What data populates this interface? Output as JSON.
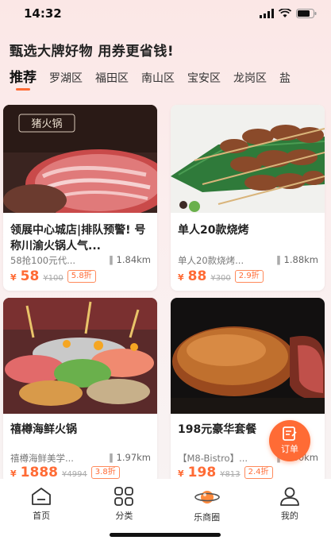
{
  "status_bar": {
    "time": "14:32"
  },
  "headline": "甄选大牌好物 用券更省钱!",
  "tabs": [
    "推荐",
    "罗湖区",
    "福田区",
    "南山区",
    "宝安区",
    "龙岗区",
    "盐"
  ],
  "cards": [
    {
      "title": "领展中心城店|排队预警! 号称川渝火锅人气...",
      "sub": "58抢100元代...",
      "distance": "1.84km",
      "currency": "¥",
      "price": "58",
      "original_price": "¥100",
      "discount": "5.8折",
      "image_label": "猪火锅"
    },
    {
      "title": "单人20款烧烤",
      "sub": "单人20款烧烤...",
      "distance": "1.88km",
      "currency": "¥",
      "price": "88",
      "original_price": "¥300",
      "discount": "2.9折"
    },
    {
      "title": "禧樽海鲜火锅",
      "sub": "禧樽海鲜美学...",
      "distance": "1.97km",
      "currency": "¥",
      "price": "1888",
      "original_price": "¥4994",
      "discount": "3.8折"
    },
    {
      "title": "198元豪华套餐",
      "sub": "【M8-Bistro】...",
      "distance": "1.60km",
      "currency": "¥",
      "price": "198",
      "original_price": "¥813",
      "discount": "2.4折"
    }
  ],
  "fab": {
    "label": "订单"
  },
  "tabbar": [
    {
      "label": "首页",
      "icon": "home-icon"
    },
    {
      "label": "分类",
      "icon": "grid-icon"
    },
    {
      "label": "乐商圈",
      "icon": "planet-icon"
    },
    {
      "label": "我的",
      "icon": "profile-icon"
    }
  ],
  "colors": {
    "accent": "#ff6b35",
    "background": "#fbe7e6"
  }
}
